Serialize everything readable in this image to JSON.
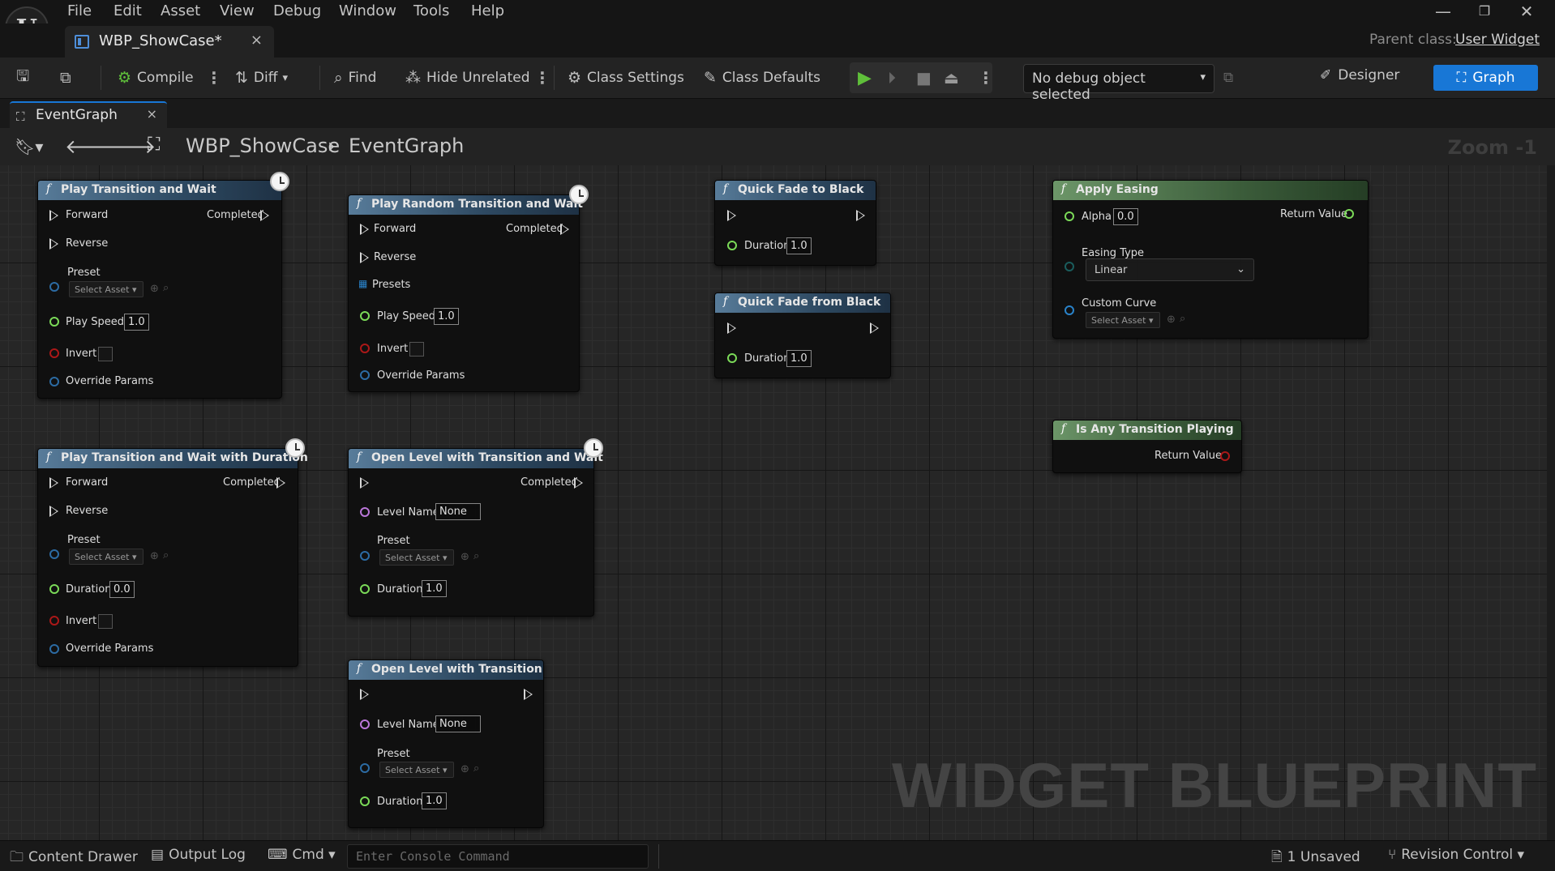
{
  "menubar": {
    "logo": "U",
    "items": [
      "File",
      "Edit",
      "Asset",
      "View",
      "Debug",
      "Window",
      "Tools",
      "Help"
    ],
    "window_buttons": {
      "minimize": "—",
      "restore": "❐",
      "close": "✕"
    }
  },
  "tabbar": {
    "document_tab": "WBP_ShowCase*",
    "close": "×",
    "parent_class_label": "Parent class:",
    "parent_class_value": "User Widget"
  },
  "toolbar": {
    "compile": "Compile",
    "diff": "Diff",
    "find": "Find",
    "hide_unrelated": "Hide Unrelated",
    "class_settings": "Class Settings",
    "class_defaults": "Class Defaults",
    "debug_object": "No debug object selected",
    "designer": "Designer",
    "graph": "Graph"
  },
  "panel": {
    "tab": "EventGraph",
    "close": "×"
  },
  "breadcrumb": {
    "root": "WBP_ShowCase",
    "current": "EventGraph",
    "separator": "›",
    "zoom": "Zoom -1"
  },
  "watermark": "WIDGET BLUEPRINT",
  "nodes": {
    "n1": {
      "title": "Play Transition and Wait",
      "forward": "Forward",
      "reverse": "Reverse",
      "completed": "Completed",
      "preset": "Preset",
      "select_asset": "Select Asset",
      "play_speed": "Play Speed",
      "play_speed_val": "1.0",
      "invert": "Invert",
      "override": "Override Params"
    },
    "n2": {
      "title": "Play Random Transition and Wait",
      "forward": "Forward",
      "reverse": "Reverse",
      "completed": "Completed",
      "presets": "Presets",
      "play_speed": "Play Speed",
      "play_speed_val": "1.0",
      "invert": "Invert",
      "override": "Override Params"
    },
    "n3": {
      "title": "Quick Fade to Black",
      "duration": "Duration",
      "duration_val": "1.0"
    },
    "n4": {
      "title": "Quick Fade from Black",
      "duration": "Duration",
      "duration_val": "1.0"
    },
    "n5": {
      "title": "Apply Easing",
      "alpha": "Alpha",
      "alpha_val": "0.0",
      "return": "Return Value",
      "easing_type": "Easing Type",
      "easing_val": "Linear",
      "custom_curve": "Custom Curve",
      "select_asset": "Select Asset"
    },
    "n6": {
      "title": "Is Any Transition Playing",
      "return": "Return Value"
    },
    "n7": {
      "title": "Play Transition and Wait with Duration",
      "forward": "Forward",
      "reverse": "Reverse",
      "completed": "Completed",
      "preset": "Preset",
      "select_asset": "Select Asset",
      "duration": "Duration",
      "duration_val": "0.0",
      "invert": "Invert",
      "override": "Override Params"
    },
    "n8": {
      "title": "Open Level with Transition and Wait",
      "completed": "Completed",
      "level_name": "Level Name",
      "level_val": "None",
      "preset": "Preset",
      "select_asset": "Select Asset",
      "duration": "Duration",
      "duration_val": "1.0"
    },
    "n9": {
      "title": "Open Level with Transition",
      "level_name": "Level Name",
      "level_val": "None",
      "preset": "Preset",
      "select_asset": "Select Asset",
      "duration": "Duration",
      "duration_val": "1.0"
    }
  },
  "statusbar": {
    "content_drawer": "Content Drawer",
    "output_log": "Output Log",
    "cmd": "Cmd",
    "console_placeholder": "Enter Console Command",
    "unsaved": "1 Unsaved",
    "revision_control": "Revision Control"
  },
  "colors": {
    "accent": "#1877d6",
    "exec": "#dddddd",
    "float_pin": "#7ee05a",
    "bool_pin": "#b01818",
    "struct_pin": "#2d6ea8",
    "name_pin": "#c07ae0",
    "object_pin": "#2a86d0"
  }
}
